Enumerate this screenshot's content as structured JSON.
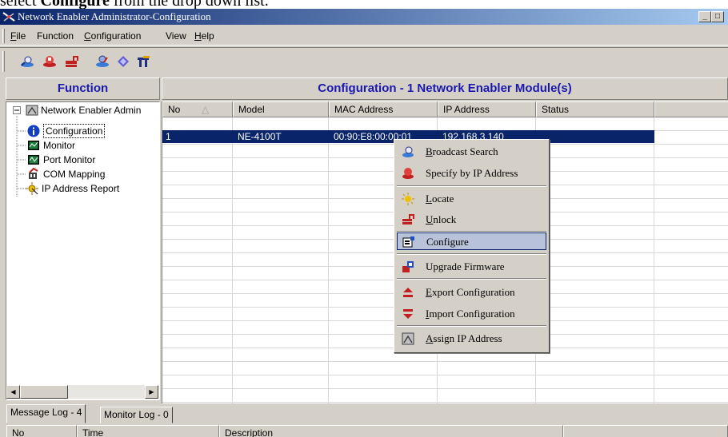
{
  "caption": {
    "prefix": "select ",
    "bold": "Configure",
    "suffix": " from the drop down list."
  },
  "window": {
    "title": "Network Enabler Administrator-Configuration",
    "controls": {
      "minimize": "_",
      "maximize": "□"
    }
  },
  "menu": [
    {
      "first": "F",
      "rest": "ile"
    },
    {
      "first": "",
      "rest": "Function"
    },
    {
      "first": "C",
      "rest": "onfiguration"
    },
    {
      "first": "",
      "rest": "View"
    },
    {
      "first": "H",
      "rest": "elp"
    }
  ],
  "toolbar": [
    "broadcast-search-icon",
    "specify-ip-icon",
    "unlock-icon",
    "configure-icon",
    "upgrade-firmware-icon",
    "com-mapping-icon"
  ],
  "function_panel": {
    "title": "Function",
    "tree": {
      "root": "Network Enabler Admin",
      "children": [
        "Configuration",
        "Monitor",
        "Port Monitor",
        "COM Mapping",
        "IP Address Report"
      ]
    }
  },
  "config_panel": {
    "title": "Configuration - 1 Network Enabler Module(s)",
    "columns": [
      "No",
      "Model",
      "MAC Address",
      "IP Address",
      "Status"
    ],
    "rows": [
      {
        "no": "1",
        "model": "NE-4100T",
        "mac": "00:90:E8:00:00:01",
        "ip": "192.168.3.140",
        "status": ""
      }
    ]
  },
  "context_menu": {
    "items": [
      {
        "u": "B",
        "rest": "roadcast Search",
        "icon": "broadcast-search-icon"
      },
      {
        "u": "",
        "rest": "Specify by IP Address",
        "icon": "specify-ip-icon"
      },
      {
        "u": "L",
        "rest": "ocate",
        "icon": "locate-icon"
      },
      {
        "u": "U",
        "rest": "nlock",
        "icon": "unlock-icon"
      },
      {
        "u": "",
        "rest": "Configure",
        "icon": "configure-icon",
        "active": true
      },
      {
        "u": "",
        "rest": "Upgrade Firmware",
        "icon": "upgrade-firmware-icon"
      },
      {
        "u": "E",
        "rest": "xport Configuration",
        "icon": "export-configuration-icon"
      },
      {
        "u": "I",
        "rest": "mport Configuration",
        "icon": "import-configuration-icon"
      },
      {
        "u": "A",
        "rest": "ssign IP Address",
        "icon": "assign-ip-icon"
      }
    ]
  },
  "bottom": {
    "tabs": [
      "Message Log - 4",
      "Monitor Log - 0"
    ],
    "log_columns": [
      "No",
      "Time",
      "Description"
    ]
  },
  "colors": {
    "accent": "#1a18b0",
    "selection": "#0a246a",
    "face": "#d4d0c8"
  }
}
